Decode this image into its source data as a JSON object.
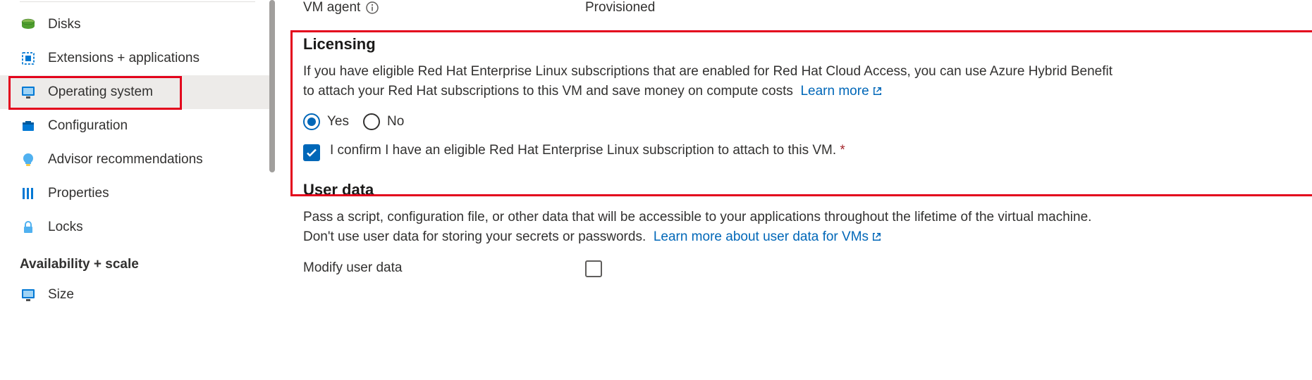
{
  "sidebar": {
    "items": [
      {
        "label": "Disks"
      },
      {
        "label": "Extensions + applications"
      },
      {
        "label": "Operating system"
      },
      {
        "label": "Configuration"
      },
      {
        "label": "Advisor recommendations"
      },
      {
        "label": "Properties"
      },
      {
        "label": "Locks"
      }
    ],
    "section_title": "Availability + scale",
    "section_items": [
      {
        "label": "Size"
      }
    ]
  },
  "main": {
    "vm_agent": {
      "label": "VM agent",
      "value": "Provisioned"
    },
    "licensing": {
      "title": "Licensing",
      "desc": "If you have eligible Red Hat Enterprise Linux subscriptions that are enabled for Red Hat Cloud Access, you can use Azure Hybrid Benefit to attach your Red Hat subscriptions to this VM and save money on compute costs",
      "learn_more": "Learn more",
      "yes": "Yes",
      "no": "No",
      "confirm": "I confirm I have an eligible Red Hat Enterprise Linux subscription to attach to this VM.",
      "required_mark": "*"
    },
    "userdata": {
      "title": "User data",
      "desc": "Pass a script, configuration file, or other data that will be accessible to your applications throughout the lifetime of the virtual machine. Don't use user data for storing your secrets or passwords.",
      "learn_more": "Learn more about user data for VMs",
      "modify_label": "Modify user data"
    }
  }
}
